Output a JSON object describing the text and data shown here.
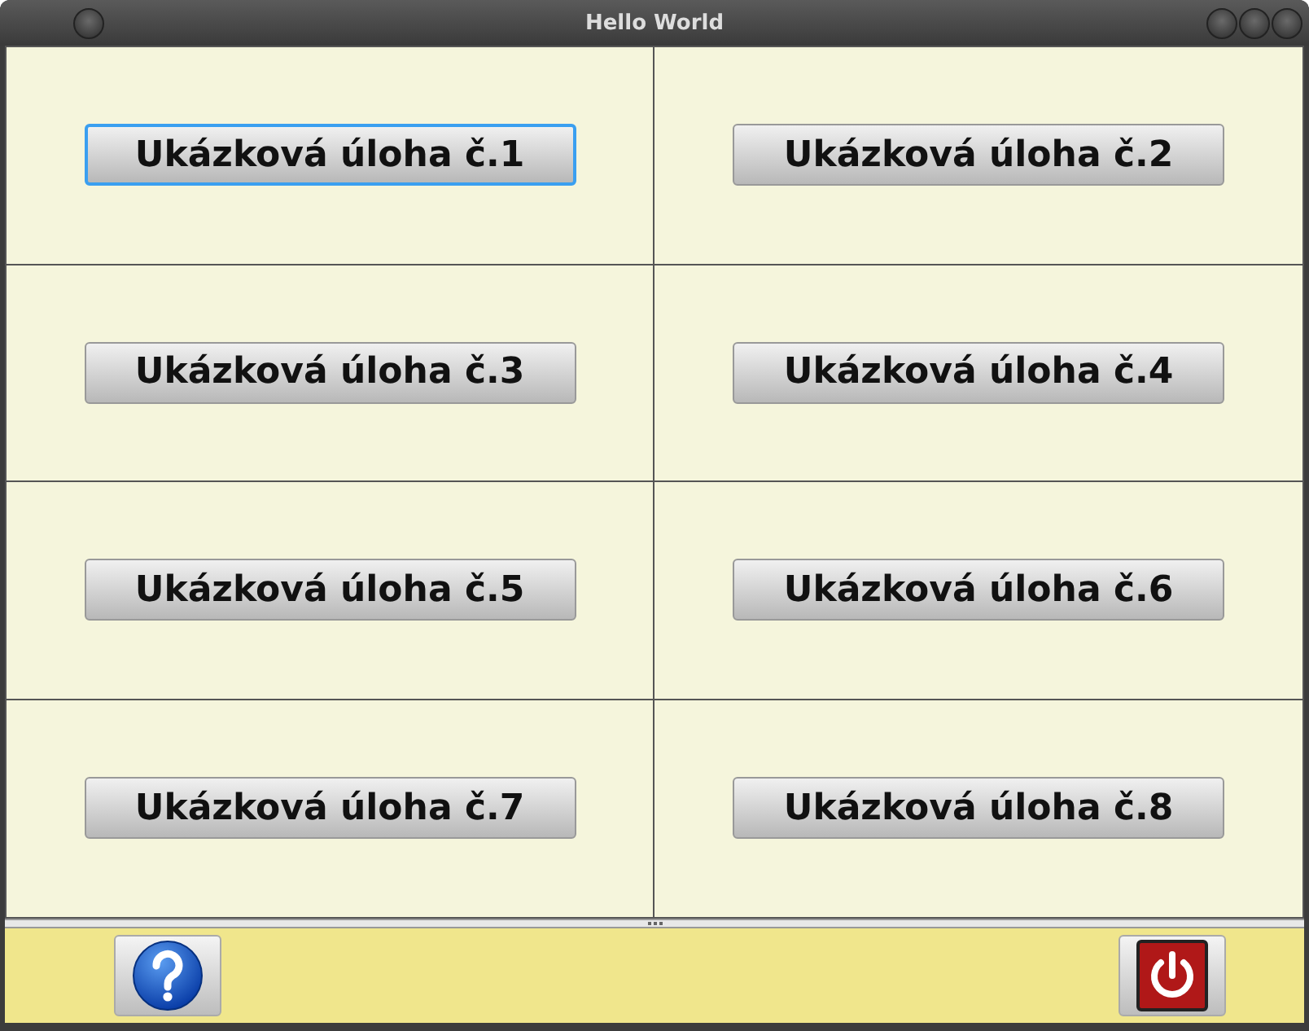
{
  "window": {
    "title": "Hello World"
  },
  "tasks": [
    {
      "label": "Ukázková úloha č.1",
      "focused": true
    },
    {
      "label": "Ukázková úloha č.2",
      "focused": false
    },
    {
      "label": "Ukázková úloha č.3",
      "focused": false
    },
    {
      "label": "Ukázková úloha č.4",
      "focused": false
    },
    {
      "label": "Ukázková úloha č.5",
      "focused": false
    },
    {
      "label": "Ukázková úloha č.6",
      "focused": false
    },
    {
      "label": "Ukázková úloha č.7",
      "focused": false
    },
    {
      "label": "Ukázková úloha č.8",
      "focused": false
    }
  ]
}
